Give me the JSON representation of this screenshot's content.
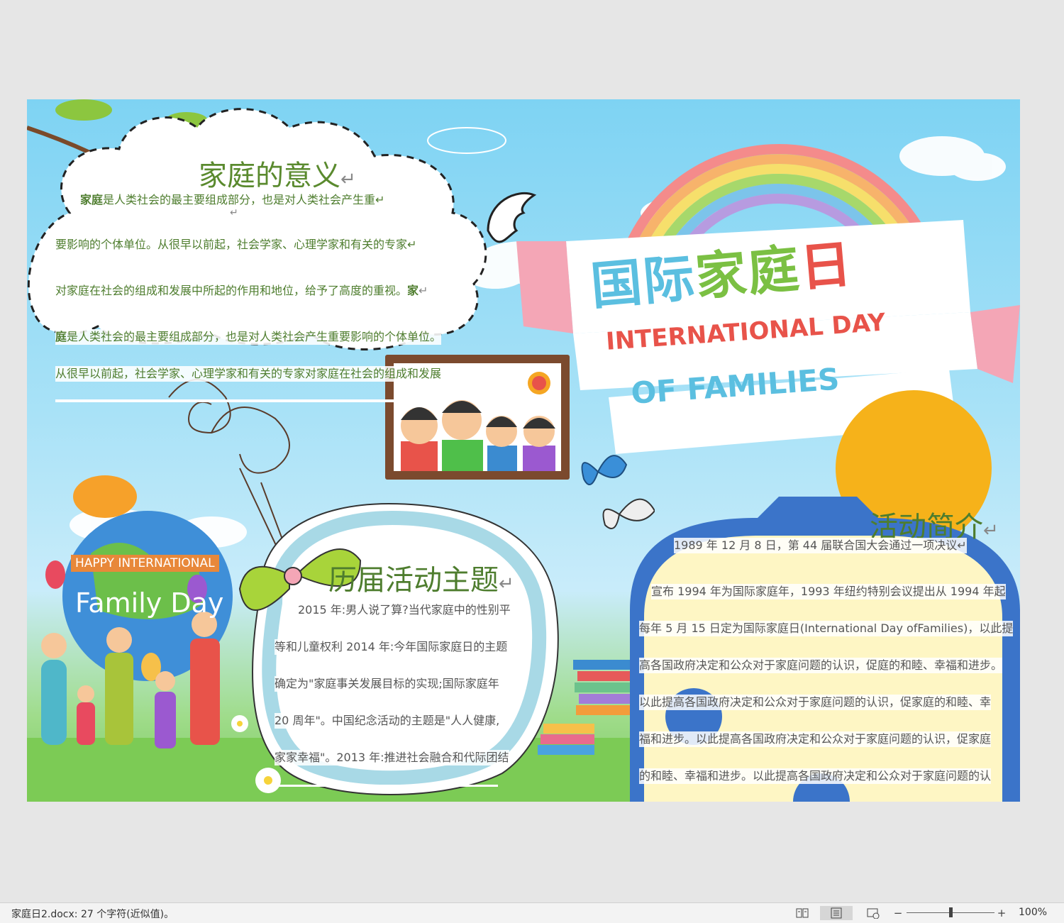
{
  "document": {
    "section1": {
      "title": "家庭的意义",
      "mark": "↵",
      "line1_bold": "家庭",
      "line1": "是人类社会的最主要组成部分，也是对人类社会产生重↵",
      "line1_mark": "↵",
      "line2": "要影响的个体单位。从很早以前起，社会学家、心理学家和有关的专家↵",
      "line3": "对家庭在社会的组成和发展中所起的作用和地位，给予了高度的重视。",
      "line3_bold": "家",
      "line3_mark": "↵",
      "line4_bold": "庭",
      "line4": "是人类社会的最主要组成部分，也是对人类社会产生重要影响的个体单位。",
      "line5": "从很早以前起，社会学家、心理学家和有关的专家对家庭在社会的组成和发展"
    },
    "banner": {
      "cn_title": "国际家庭日",
      "en_line1": "INTERNATIONAL DAY",
      "en_line2": "OF FAMILIES"
    },
    "sign": {
      "line1": "HAPPY INTERNATIONAL",
      "line2": "Family Day"
    },
    "section2": {
      "title": "历届活动主题",
      "mark": "↵",
      "lines": [
        "2015 年:男人说了算?当代家庭中的性别平",
        "等和儿童权利 2014 年:今年国际家庭日的主题",
        "确定为\"家庭事关发展目标的实现;国际家庭年",
        "20 周年\"。中国纪念活动的主题是\"人人健康,",
        "家家幸福\"。2013 年:推进社会融合和代际团结"
      ]
    },
    "section3": {
      "title": "活动简介",
      "mark": "↵",
      "lines": [
        "1989 年 12 月 8 日，第 44 届联合国大会通过一项决议↵",
        "宣布 1994 年为国际家庭年，1993 年纽约特别会议提出从 1994 年起",
        "每年 5 月 15 日定为国际家庭日(International Day ofFamilies)，以此提",
        "高各国政府决定和公众对于家庭问题的认识，促庭的和睦、幸福和进步。",
        "以此提高各国政府决定和公众对于家庭问题的认识，促家庭的和睦、幸",
        "福和进步。以此提高各国政府决定和公众对于家庭问题的认识，促家庭",
        "的和睦、幸福和进步。以此提高各国政府决定和公众对于家庭问题的认"
      ]
    }
  },
  "statusbar": {
    "doc_info": "家庭日2.docx: 27 个字符(近似值)。",
    "zoom_minus": "−",
    "zoom_plus": "+",
    "zoom_level": "100%",
    "zoom_fraction": 0.5
  },
  "colors": {
    "title_green": "#5a8a2e",
    "banner_blue": "#5bbfe0",
    "banner_green": "#7bc043",
    "banner_red": "#e8534a",
    "sign_orange": "#e8883a"
  }
}
